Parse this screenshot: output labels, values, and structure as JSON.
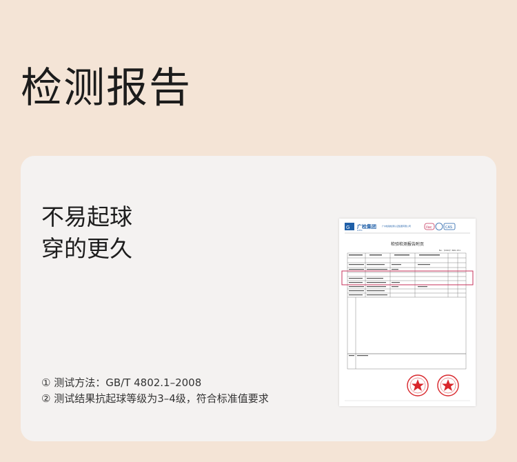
{
  "page": {
    "title": "检测报告"
  },
  "card": {
    "headline_lines": [
      "不易起球",
      "穿的更久"
    ],
    "notes": [
      "① 测试方法：GB/T 4802.1–2008",
      "② 测试结果抗起球等级为3–4级，符合标准值要求"
    ]
  },
  "report_image": {
    "logo_text": "广检集团",
    "logo_sub": "GTTC",
    "header_text": "广州检验检测认证集团有限公司",
    "doc_title": "检验检测报告附页",
    "doc_no": "No.（2019）660-151",
    "highlight_color": "#c4325a",
    "brand_color": "#1f5fa8",
    "stamp_color": "#d8262b"
  },
  "colors": {
    "background": "#f4e4d6",
    "card": "#f4f2f1"
  }
}
